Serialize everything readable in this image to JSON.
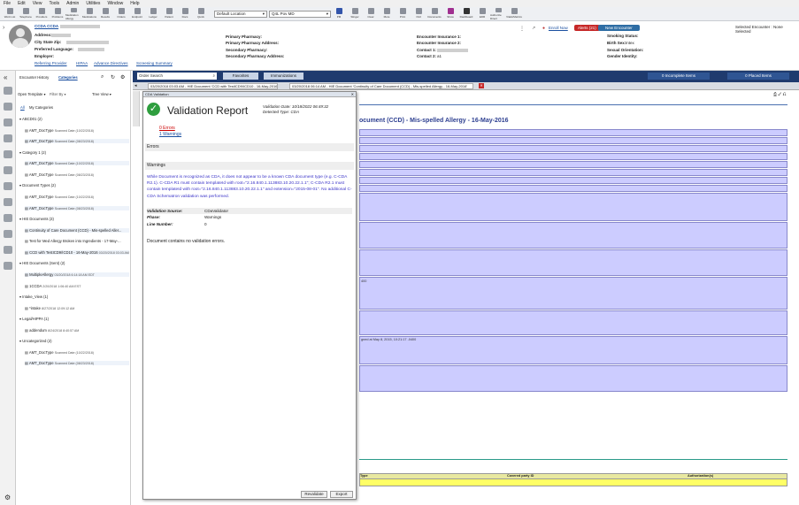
{
  "menu": [
    "File",
    "Edit",
    "View",
    "Tools",
    "Admin",
    "Utilities",
    "Window",
    "Help"
  ],
  "toolbar": {
    "left_buttons": [
      "Work List",
      "Telephone",
      "Providers",
      "Problems",
      "Medication Allergy",
      "Medications",
      "Results",
      "Orders",
      "Endpoint",
      "Ledger",
      "Patient",
      "Docs",
      "Quick"
    ],
    "location": "Default Location",
    "provider": "Q4L Pov MD",
    "right_buttons": [
      "PM",
      "Slinger",
      "Clear",
      "More",
      "Print",
      "OHI",
      "Documents",
      "Show",
      "Dashboard",
      "EDR",
      "Authorize Direct",
      "Vitals/Metrics"
    ]
  },
  "patient": {
    "name": "CCDA CCDA",
    "fields": {
      "address": "Address:",
      "city": "City State Zip:",
      "language": "Preferred Language:",
      "employer": "Employer:"
    },
    "links": [
      "Referring Provider",
      "HIPAA",
      "Advance Directives",
      "Screening Summary"
    ],
    "pharmacy": [
      "Primary Pharmacy:",
      "Primary Pharmacy Address:",
      "Secondary Pharmacy:",
      "Secondary Pharmacy Address:"
    ],
    "insurance": [
      "Encounter Insurance 1:",
      "Encounter Insurance 2:",
      "Contact 1:",
      "Contact 2:"
    ],
    "contact2_value": "a1",
    "enroll": "Enroll Now",
    "alerts": "Alerts (21)",
    "new_encounter": "New Encounter",
    "selected_encounter": "Selected Encounter : None Selected",
    "right_fields": [
      "Smoking Status:",
      "Birth Sex:",
      "Sexual Orientation:",
      "Gender Identity:"
    ],
    "birth_sex_value": "Intex"
  },
  "sidepanel": {
    "tabs": [
      "Encounter History",
      "Categories"
    ],
    "open_template": "Open Template",
    "filter": "Filter By",
    "tree_view": "Tree View",
    "subtabs": [
      "All",
      "My Categories"
    ],
    "items": [
      {
        "t": "ABCD01 (2)",
        "level": 0
      },
      {
        "t": "AMT_DocType",
        "d": "Scanned Date (10/22/2018)",
        "level": 1
      },
      {
        "t": "AMT_DocType",
        "d": "Scanned Date (08/23/2018)",
        "level": 1
      },
      {
        "t": "Category 1 (2)",
        "level": 0
      },
      {
        "t": "AMT_DocType",
        "d": "Scanned Date (10/22/2018)",
        "level": 1
      },
      {
        "t": "AMT_DocType",
        "d": "Scanned Date (08/23/2018)",
        "level": 1
      },
      {
        "t": "Document Types (2)",
        "level": 0
      },
      {
        "t": "AMT_DocType",
        "d": "Scanned Date (10/22/2018)",
        "level": 1
      },
      {
        "t": "AMT_DocType",
        "d": "Scanned Date (08/23/2018)",
        "level": 1
      },
      {
        "t": "HIE Documents (3)",
        "level": 0
      },
      {
        "t": "Continuity of Care Document (CCD) - Mis-spelled Aller...",
        "level": 1
      },
      {
        "t": "Test for Med Allergy Broken into Ingredients - 17-May-...",
        "level": 1
      },
      {
        "t": "CCD with TestICD9/ICD10 - 16-May-2016",
        "d": "03/20/2018 03:03 AM EDT",
        "level": 1
      },
      {
        "t": "HIE Documents (Sent) (2)",
        "level": 0
      },
      {
        "t": "MultipleAllergy",
        "d": "03/20/2018 6:14:18 AM EDT",
        "level": 1
      },
      {
        "t": "1CCDA",
        "d": "2/20/2018 1:06:40 AM EST",
        "level": 1
      },
      {
        "t": "Intake_View (1)",
        "level": 0
      },
      {
        "t": "*intake",
        "d": "8/27/2018 12:09:12 AM",
        "level": 1
      },
      {
        "t": "Legal/HIPPA (1)",
        "level": 0
      },
      {
        "t": "addendum",
        "d": "8/24/2018 8:40:57 AM",
        "level": 1
      },
      {
        "t": "Uncategorized (2)",
        "level": 0
      },
      {
        "t": "AMT_DocType",
        "d": "Scanned Date (10/22/2018)",
        "level": 1
      },
      {
        "t": "AMT_DocType",
        "d": "Scanned Date (08/23/2018)",
        "level": 1
      }
    ]
  },
  "bluebar": {
    "search_placeholder": "Order Search",
    "favorites": "Favorites",
    "immunizations": "Immunizations",
    "incomplete": "0 Incomplete Items",
    "placed": "0 Placed Items"
  },
  "doc_tabs": [
    "03/20/2018 03:03 AM - HIE Document 'CCD with TestICD9/ICD10 - 16-May-2016'",
    "03/20/2018 06:14 AM - HIE Document 'Continuity of Care Document (CCD) - Mis-spelled Allergy - 16-May-2016'"
  ],
  "doc": {
    "heading": "ocument (CCD) - Mis-spelled Allergy - 16-May-2016",
    "frag1": "400",
    "frag2": "gned at May 8, 2015, 10:21:17 -0400",
    "table_headers": [
      "Type",
      "Covered party ID",
      "Authorization(s)"
    ]
  },
  "modal": {
    "window_title": "CDA Validation",
    "title": "Validation Report",
    "validation_date_label": "Validation Date:",
    "validation_date": "10/18/2022 06:49:32",
    "detected_type_label": "Detected Type:",
    "detected_type": "CDA",
    "errors_link": "0 Errors",
    "warnings_link": "1 Warnings",
    "errors_header": "Errors",
    "warnings_header": "Warnings",
    "warning_text": "While Document is recognized as CDA, it does not appear to be a known CDA document type (e.g. C-CDA R2.1). C-CDA R1 must contain templateId with root=\"2.16.840.1.113883.10.20.22.1.1\"; C-CDA R2.1 must contain templateId with root=\"2.16.840.1.113883.10.20.22.1.1\" and extension=\"2015-08-01\". No additional C-CDA Schematron validation was performed.",
    "source_label": "Validation Source:",
    "source": "CDaValidator",
    "phase_label": "Phase:",
    "phase": "Warnings",
    "line_label": "Line Number:",
    "line": "0",
    "summary": "Document contains no validation errors.",
    "revalidate": "Revalidate",
    "export": "Export"
  }
}
